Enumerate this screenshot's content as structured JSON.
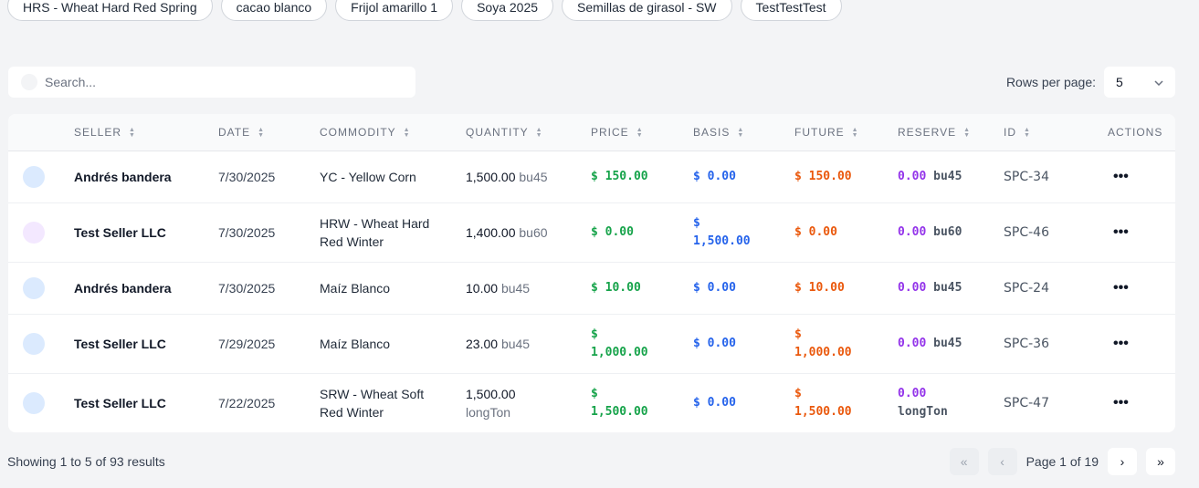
{
  "filters": [
    "HRS - Wheat Hard Red Spring",
    "cacao blanco",
    "Frijol amarillo 1",
    "Soya 2025",
    "Semillas de girasol - SW",
    "TestTestTest"
  ],
  "search": {
    "placeholder": "Search...",
    "icon": "search-icon"
  },
  "rows_per_page": {
    "label": "Rows per page:",
    "value": "5",
    "icon": "chevron-down-icon"
  },
  "columns": {
    "seller": "SELLER",
    "date": "DATE",
    "commodity": "COMMODITY",
    "quantity": "QUANTITY",
    "price": "PRICE",
    "basis": "BASIS",
    "future": "FUTURE",
    "reserve": "RESERVE",
    "id": "ID",
    "actions": "ACTIONS"
  },
  "rows": [
    {
      "seller": "Andrés bandera",
      "date": "7/30/2025",
      "commodity": [
        "YC - Yellow Corn"
      ],
      "quantity": [
        "1,500.00",
        "bu45"
      ],
      "price": [
        "$ 150.00"
      ],
      "basis": [
        "$ 0.00"
      ],
      "future": [
        "$ 150.00"
      ],
      "reserve": [
        "0.00",
        "bu45"
      ],
      "id": "SPC-34",
      "actions": "•••"
    },
    {
      "seller": "Test Seller LLC",
      "date": "7/30/2025",
      "commodity": [
        "HRW - Wheat Hard",
        "Red Winter"
      ],
      "quantity": [
        "1,400.00",
        "bu60"
      ],
      "price": [
        "$ 0.00"
      ],
      "basis": [
        "$",
        "1,500.00"
      ],
      "future": [
        "$ 0.00"
      ],
      "reserve": [
        "0.00",
        "bu60"
      ],
      "id": "SPC-46",
      "actions": "•••"
    },
    {
      "seller": "Andrés bandera",
      "date": "7/30/2025",
      "commodity": [
        "Maíz Blanco"
      ],
      "quantity": [
        "10.00",
        "bu45"
      ],
      "price": [
        "$ 10.00"
      ],
      "basis": [
        "$ 0.00"
      ],
      "future": [
        "$ 10.00"
      ],
      "reserve": [
        "0.00",
        "bu45"
      ],
      "id": "SPC-24",
      "actions": "•••"
    },
    {
      "seller": "Test Seller LLC",
      "date": "7/29/2025",
      "commodity": [
        "Maíz Blanco"
      ],
      "quantity": [
        "23.00",
        "bu45"
      ],
      "price": [
        "$",
        "1,000.00"
      ],
      "basis": [
        "$ 0.00"
      ],
      "future": [
        "$",
        "1,000.00"
      ],
      "reserve": [
        "0.00",
        "bu45"
      ],
      "id": "SPC-36",
      "actions": "•••"
    },
    {
      "seller": "Test Seller LLC",
      "date": "7/22/2025",
      "commodity": [
        "SRW - Wheat Soft",
        "Red Winter"
      ],
      "quantity": [
        "1,500.00",
        "longTon"
      ],
      "price": [
        "$",
        "1,500.00"
      ],
      "basis": [
        "$ 0.00"
      ],
      "future": [
        "$",
        "1,500.00"
      ],
      "reserve": [
        "0.00",
        "longTon"
      ],
      "id": "SPC-47",
      "actions": "•••"
    }
  ],
  "footer": {
    "summary": "Showing 1 to 5 of 93 results",
    "page_label": "Page 1 of 19",
    "first": "«",
    "prev": "‹",
    "next": "›",
    "last": "»"
  },
  "colors": {
    "price": "#16a34a",
    "basis": "#2563eb",
    "future": "#ea580c",
    "reserve": "#9333ea"
  }
}
